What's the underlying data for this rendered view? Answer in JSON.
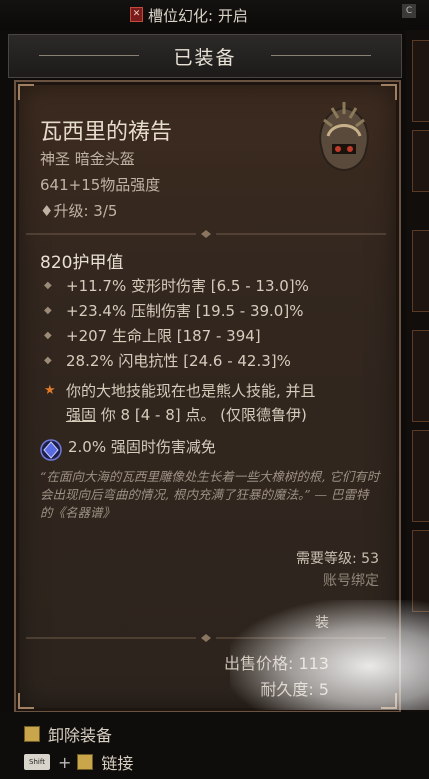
{
  "topbar": {
    "toggle_icon": "transmog-toggle-icon",
    "transmog_label": "槽位幻化: 开启",
    "corner_key": "C"
  },
  "header": {
    "title": "已装备"
  },
  "item": {
    "name": "瓦西里的祷告",
    "type": "神圣 暗金头盔",
    "power": "641+15物品强度",
    "upgrade": "♦升级: 3/5",
    "armor": "820护甲值",
    "affixes": [
      "+11.7% 变形时伤害 [6.5 - 13.0]%",
      "+23.4% 压制伤害 [19.5 - 39.0]%",
      "+207 生命上限 [187 - 394]",
      "28.2% 闪电抗性 [24.6 - 42.3]%"
    ],
    "unique_line1": "你的大地技能现在也是熊人技能, 并且",
    "unique_line2_underlined": "强固",
    "unique_line2_rest": " 你 8 [4 - 8] 点。 (仅限德鲁伊)",
    "gem_affix": "2.0% 强固时伤害减免",
    "flavor": "“在面向大海的瓦西里雕像处生长着一些大橡树的根, 它们有时会出现向后弯曲的情况, 根内充满了狂暴的魔法。” — 巴雷特的《名器谱》",
    "required_level": "需要等级: 53",
    "account_bound": "账号绑定",
    "equipped_partial": "装",
    "sell_value": "出售价格: 113",
    "durability": "耐久度: 5"
  },
  "footer": {
    "unequip_label": "卸除装备",
    "link_key": "Shift",
    "link_plus": "+",
    "link_label": "链接"
  },
  "colors": {
    "unique_bullet": "#e07a2a",
    "tooltip_bg": "#33271f",
    "border": "#6b5341"
  }
}
